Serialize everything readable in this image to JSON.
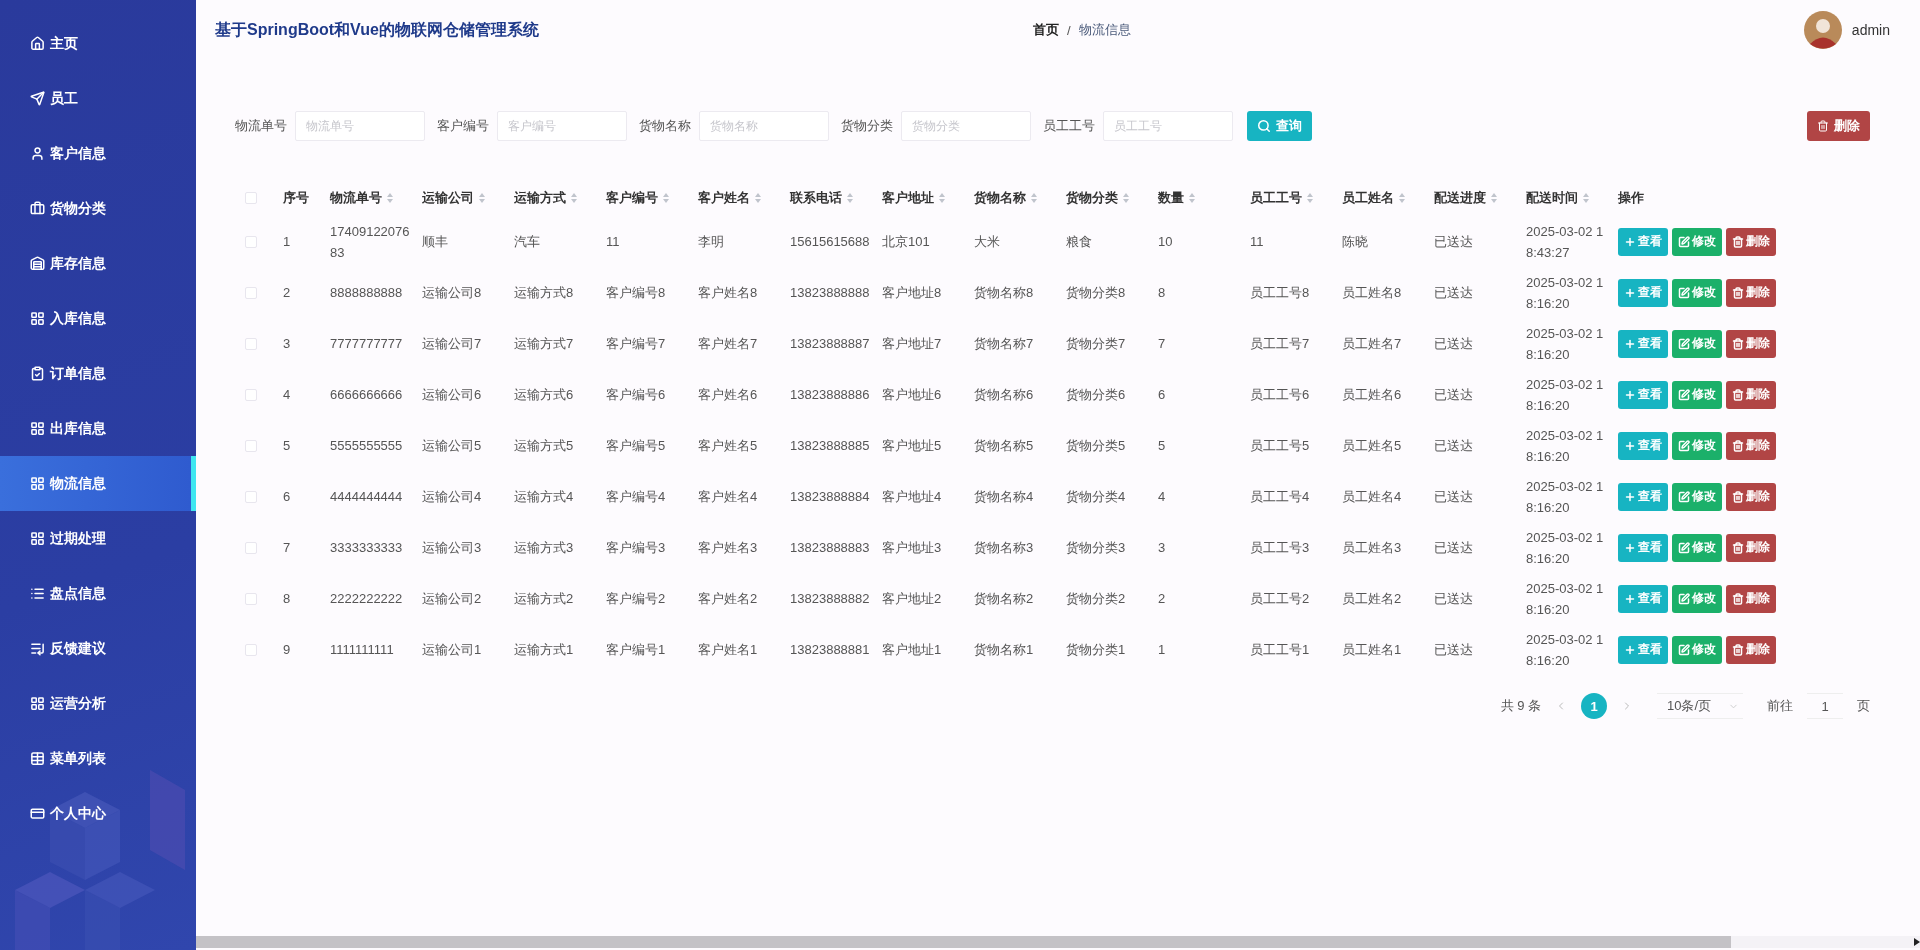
{
  "sidebar": {
    "items": [
      {
        "label": "主页",
        "selected": false
      },
      {
        "label": "员工",
        "selected": false
      },
      {
        "label": "客户信息",
        "selected": false
      },
      {
        "label": "货物分类",
        "selected": false
      },
      {
        "label": "库存信息",
        "selected": false
      },
      {
        "label": "入库信息",
        "selected": false
      },
      {
        "label": "订单信息",
        "selected": false
      },
      {
        "label": "出库信息",
        "selected": false
      },
      {
        "label": "物流信息",
        "selected": true
      },
      {
        "label": "过期处理",
        "selected": false
      },
      {
        "label": "盘点信息",
        "selected": false
      },
      {
        "label": "反馈建议",
        "selected": false
      },
      {
        "label": "运营分析",
        "selected": false
      },
      {
        "label": "菜单列表",
        "selected": false
      },
      {
        "label": "个人中心",
        "selected": false
      }
    ]
  },
  "header": {
    "title": "基于SpringBoot和Vue的物联网仓储管理系统",
    "breadcrumb_separator": "/",
    "breadcrumb": [
      {
        "label": "首页",
        "current": false
      },
      {
        "label": "物流信息",
        "current": true
      }
    ],
    "user": {
      "name": "admin"
    }
  },
  "search": {
    "fields": [
      {
        "label": "物流单号",
        "placeholder": "物流单号"
      },
      {
        "label": "客户编号",
        "placeholder": "客户编号"
      },
      {
        "label": "货物名称",
        "placeholder": "货物名称"
      },
      {
        "label": "货物分类",
        "placeholder": "货物分类"
      },
      {
        "label": "员工工号",
        "placeholder": "员工工号"
      }
    ],
    "query_button": "查询",
    "delete_button": "删除"
  },
  "table": {
    "header_checked": false,
    "columns": [
      {
        "label": "序号",
        "sortable": false
      },
      {
        "label": "物流单号",
        "sortable": true
      },
      {
        "label": "运输公司",
        "sortable": true
      },
      {
        "label": "运输方式",
        "sortable": true
      },
      {
        "label": "客户编号",
        "sortable": true
      },
      {
        "label": "客户姓名",
        "sortable": true
      },
      {
        "label": "联系电话",
        "sortable": true
      },
      {
        "label": "客户地址",
        "sortable": true
      },
      {
        "label": "货物名称",
        "sortable": true
      },
      {
        "label": "货物分类",
        "sortable": true
      },
      {
        "label": "数量",
        "sortable": true
      },
      {
        "label": "员工工号",
        "sortable": true
      },
      {
        "label": "员工姓名",
        "sortable": true
      },
      {
        "label": "配送进度",
        "sortable": true
      },
      {
        "label": "配送时间",
        "sortable": true
      },
      {
        "label": "操作",
        "sortable": false
      }
    ],
    "rows": [
      {
        "checked": false,
        "cells": [
          "1",
          "1740912207683",
          "顺丰",
          "汽车",
          "11",
          "李明",
          "15615615688",
          "北京101",
          "大米",
          "粮食",
          "10",
          "11",
          "陈晓",
          "已送达",
          "2025-03-02 18:43:27"
        ],
        "actions": [
          {
            "kind": "view",
            "label": "查看"
          },
          {
            "kind": "edit",
            "label": "修改"
          },
          {
            "kind": "delete",
            "label": "删除"
          }
        ]
      },
      {
        "checked": false,
        "cells": [
          "2",
          "8888888888",
          "运输公司8",
          "运输方式8",
          "客户编号8",
          "客户姓名8",
          "13823888888",
          "客户地址8",
          "货物名称8",
          "货物分类8",
          "8",
          "员工工号8",
          "员工姓名8",
          "已送达",
          "2025-03-02 18:16:20"
        ],
        "actions": [
          {
            "kind": "view",
            "label": "查看"
          },
          {
            "kind": "edit",
            "label": "修改"
          },
          {
            "kind": "delete",
            "label": "删除"
          }
        ]
      },
      {
        "checked": false,
        "cells": [
          "3",
          "7777777777",
          "运输公司7",
          "运输方式7",
          "客户编号7",
          "客户姓名7",
          "13823888887",
          "客户地址7",
          "货物名称7",
          "货物分类7",
          "7",
          "员工工号7",
          "员工姓名7",
          "已送达",
          "2025-03-02 18:16:20"
        ],
        "actions": [
          {
            "kind": "view",
            "label": "查看"
          },
          {
            "kind": "edit",
            "label": "修改"
          },
          {
            "kind": "delete",
            "label": "删除"
          }
        ]
      },
      {
        "checked": false,
        "cells": [
          "4",
          "6666666666",
          "运输公司6",
          "运输方式6",
          "客户编号6",
          "客户姓名6",
          "13823888886",
          "客户地址6",
          "货物名称6",
          "货物分类6",
          "6",
          "员工工号6",
          "员工姓名6",
          "已送达",
          "2025-03-02 18:16:20"
        ],
        "actions": [
          {
            "kind": "view",
            "label": "查看"
          },
          {
            "kind": "edit",
            "label": "修改"
          },
          {
            "kind": "delete",
            "label": "删除"
          }
        ]
      },
      {
        "checked": false,
        "cells": [
          "5",
          "5555555555",
          "运输公司5",
          "运输方式5",
          "客户编号5",
          "客户姓名5",
          "13823888885",
          "客户地址5",
          "货物名称5",
          "货物分类5",
          "5",
          "员工工号5",
          "员工姓名5",
          "已送达",
          "2025-03-02 18:16:20"
        ],
        "actions": [
          {
            "kind": "view",
            "label": "查看"
          },
          {
            "kind": "edit",
            "label": "修改"
          },
          {
            "kind": "delete",
            "label": "删除"
          }
        ]
      },
      {
        "checked": false,
        "cells": [
          "6",
          "4444444444",
          "运输公司4",
          "运输方式4",
          "客户编号4",
          "客户姓名4",
          "13823888884",
          "客户地址4",
          "货物名称4",
          "货物分类4",
          "4",
          "员工工号4",
          "员工姓名4",
          "已送达",
          "2025-03-02 18:16:20"
        ],
        "actions": [
          {
            "kind": "view",
            "label": "查看"
          },
          {
            "kind": "edit",
            "label": "修改"
          },
          {
            "kind": "delete",
            "label": "删除"
          }
        ]
      },
      {
        "checked": false,
        "cells": [
          "7",
          "3333333333",
          "运输公司3",
          "运输方式3",
          "客户编号3",
          "客户姓名3",
          "13823888883",
          "客户地址3",
          "货物名称3",
          "货物分类3",
          "3",
          "员工工号3",
          "员工姓名3",
          "已送达",
          "2025-03-02 18:16:20"
        ],
        "actions": [
          {
            "kind": "view",
            "label": "查看"
          },
          {
            "kind": "edit",
            "label": "修改"
          },
          {
            "kind": "delete",
            "label": "删除"
          }
        ]
      },
      {
        "checked": false,
        "cells": [
          "8",
          "2222222222",
          "运输公司2",
          "运输方式2",
          "客户编号2",
          "客户姓名2",
          "13823888882",
          "客户地址2",
          "货物名称2",
          "货物分类2",
          "2",
          "员工工号2",
          "员工姓名2",
          "已送达",
          "2025-03-02 18:16:20"
        ],
        "actions": [
          {
            "kind": "view",
            "label": "查看"
          },
          {
            "kind": "edit",
            "label": "修改"
          },
          {
            "kind": "delete",
            "label": "删除"
          }
        ]
      },
      {
        "checked": false,
        "cells": [
          "9",
          "1111111111",
          "运输公司1",
          "运输方式1",
          "客户编号1",
          "客户姓名1",
          "13823888881",
          "客户地址1",
          "货物名称1",
          "货物分类1",
          "1",
          "员工工号1",
          "员工姓名1",
          "已送达",
          "2025-03-02 18:16:20"
        ],
        "actions": [
          {
            "kind": "view",
            "label": "查看"
          },
          {
            "kind": "edit",
            "label": "修改"
          },
          {
            "kind": "delete",
            "label": "删除"
          }
        ]
      }
    ]
  },
  "pagination": {
    "total": "共 9 条",
    "pages": [
      {
        "label": "1",
        "selected": true
      }
    ],
    "page_size": "10条/页",
    "goto_label": "前往",
    "goto_value": "1",
    "page_suffix": "页"
  }
}
